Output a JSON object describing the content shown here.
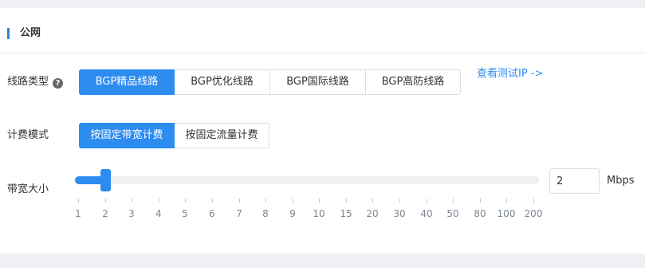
{
  "section": {
    "title": "公网"
  },
  "line_type": {
    "label": "线路类型",
    "help_icon": "question-circle-icon",
    "options": [
      "BGP精品线路",
      "BGP优化线路",
      "BGP国际线路",
      "BGP高防线路"
    ],
    "selected": "BGP精品线路",
    "test_ip_link": "查看测试IP ->"
  },
  "billing": {
    "label": "计费模式",
    "options": [
      "按固定带宽计费",
      "按固定流量计费"
    ],
    "selected": "按固定带宽计费"
  },
  "bandwidth": {
    "label": "带宽大小",
    "value": "2",
    "unit": "Mbps",
    "ticks": [
      "1",
      "2",
      "3",
      "4",
      "5",
      "6",
      "7",
      "8",
      "9",
      "10",
      "15",
      "20",
      "30",
      "40",
      "50",
      "80",
      "100",
      "200"
    ]
  },
  "colors": {
    "accent": "#2d8cf0",
    "section_bar": "#2b85e4"
  }
}
